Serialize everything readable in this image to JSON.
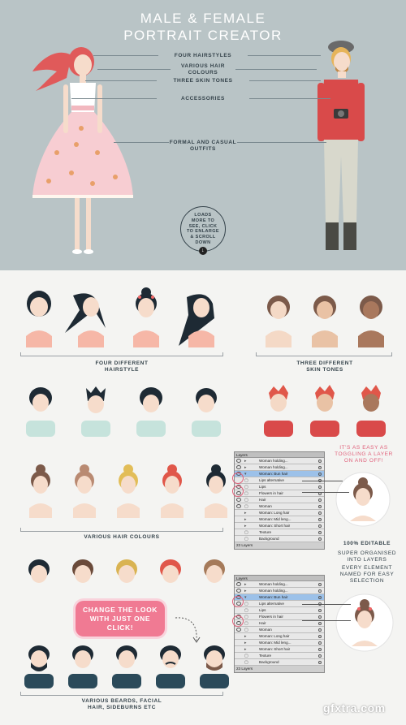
{
  "hero": {
    "title_line1": "MALE & FEMALE",
    "title_line2": "PORTRAIT CREATOR",
    "features": [
      "FOUR HAIRSTYLES",
      "VARIOUS HAIR COLOURS",
      "THREE SKIN TONES",
      "ACCESSORIES",
      "FORMAL AND CASUAL OUTFITS"
    ],
    "loads": [
      "LOADS",
      "MORE TO",
      "SEE, CLICK",
      "TO ENLARGE",
      "& SCROLL",
      "DOWN"
    ],
    "colors": {
      "background": "#b9c4c6",
      "text": "#34424a"
    }
  },
  "sections": {
    "hairstyle_label_1": "FOUR DIFFERENT",
    "hairstyle_label_2": "HAIRSTYLE",
    "skin_label_1": "THREE DIFFERENT",
    "skin_label_2": "SKIN TONES",
    "hair_colours_label": "VARIOUS HAIR COLOURS",
    "beards_label_1": "VARIOUS BEARDS, FACIAL",
    "beards_label_2": "HAIR, SIDEBURNS ETC"
  },
  "notes": {
    "toggle_1": "IT'S AS EASY AS",
    "toggle_2": "TOGGLING A LAYER",
    "toggle_3": "ON AND OFF!",
    "editable": "100% EDITABLE",
    "organised_1": "SUPER ORGANISED",
    "organised_2": "INTO LAYERS",
    "named_1": "EVERY ELEMENT",
    "named_2": "NAMED FOR EASY",
    "named_3": "SELECTION"
  },
  "cta": {
    "line1": "CHANGE THE LOOK",
    "line2": "WITH JUST ONE",
    "line3": "CLICK!"
  },
  "panel1": {
    "title": "Layers",
    "rows": [
      "Woman holding...",
      "Woman holding...",
      "Woman: Bun hair",
      "Lips alternative",
      "Lips",
      "Flowers in hair",
      "Hair",
      "Woman",
      "Woman: Long hair",
      "Woman: Mid leng...",
      "Woman: Short hair",
      "Texture",
      "Background"
    ],
    "footer": "23 Layers"
  },
  "panel2": {
    "title": "Layers",
    "rows": [
      "Woman holding...",
      "Woman holding...",
      "Woman: Bun hair",
      "Lips alternative",
      "Lips",
      "Flowers in hair",
      "Hair",
      "Woman",
      "Woman: Long hair",
      "Woman: Mid leng...",
      "Woman: Short hair",
      "Texture",
      "Background"
    ],
    "footer": "23 Layers"
  },
  "watermark": "gfxtra.com",
  "figures": {
    "hair_colors": [
      "#1e2a34",
      "#1e2a34",
      "#1e2a34",
      "#1e2a34"
    ],
    "skin_tones": [
      "#f4d9c6",
      "#e9c2a5",
      "#a9785d"
    ],
    "male_skin_tones": [
      "#f4d9c6",
      "#e9c2a5",
      "#a9785d"
    ],
    "hair_colour_set": [
      "#7c5a4a",
      "#b98a72",
      "#e2bd58",
      "#e0574a",
      "#1e2a34"
    ],
    "male_hair_colour_set": [
      "#1e2a34",
      "#6a4a3a",
      "#d9b352",
      "#e0574a",
      "#a57a5a"
    ]
  }
}
